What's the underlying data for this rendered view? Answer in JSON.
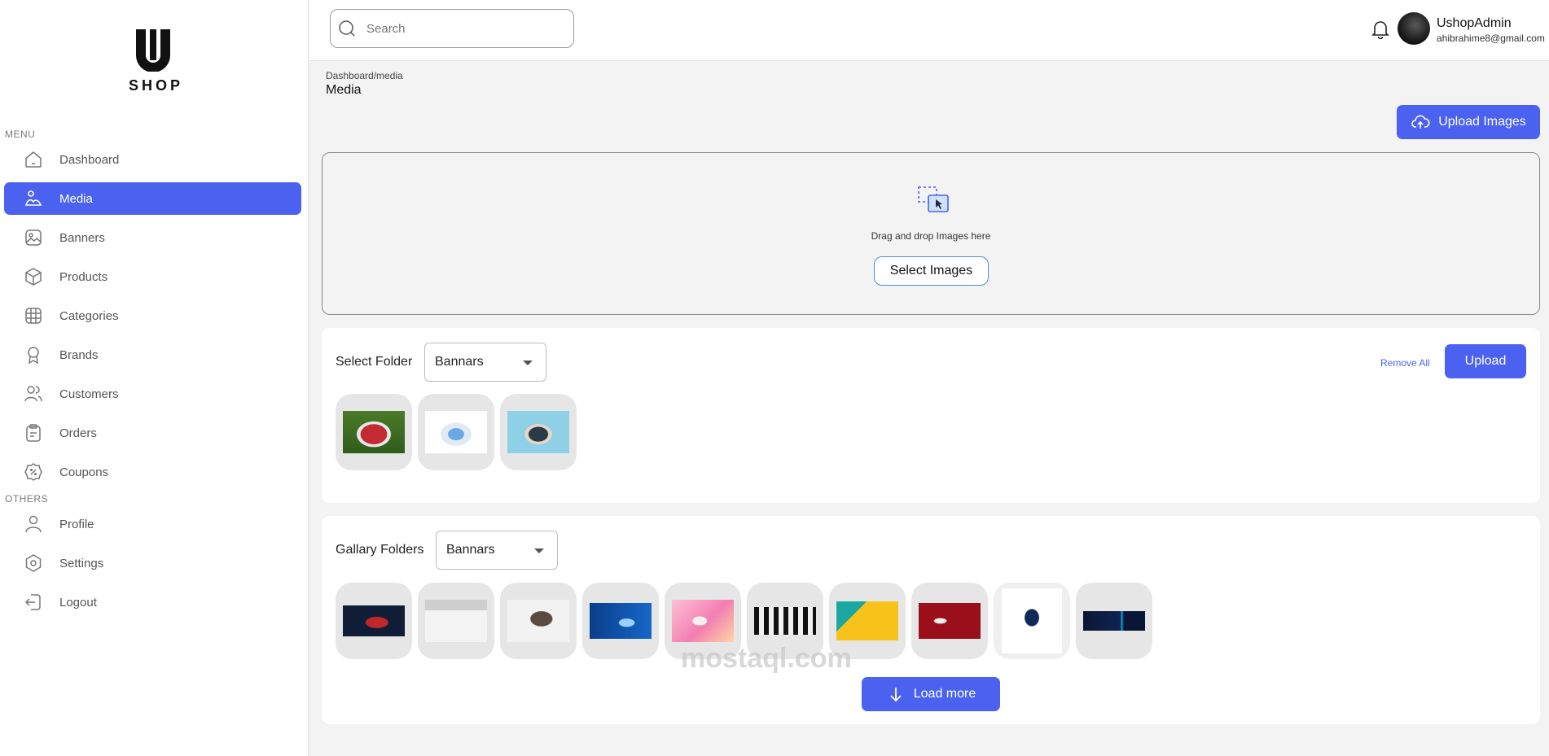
{
  "brand": {
    "logo_letter": "U",
    "name": "SHOP"
  },
  "sidebar": {
    "menu_heading": "MENU",
    "others_heading": "OTHERS",
    "items": [
      {
        "label": "Dashboard",
        "icon": "home-icon"
      },
      {
        "label": "Media",
        "icon": "media-icon",
        "active": true
      },
      {
        "label": "Banners",
        "icon": "image-icon"
      },
      {
        "label": "Products",
        "icon": "box-icon"
      },
      {
        "label": "Categories",
        "icon": "grid-icon"
      },
      {
        "label": "Brands",
        "icon": "badge-icon"
      },
      {
        "label": "Customers",
        "icon": "users-icon"
      },
      {
        "label": "Orders",
        "icon": "clipboard-icon"
      },
      {
        "label": "Coupons",
        "icon": "coupon-icon"
      }
    ],
    "others": [
      {
        "label": "Profile",
        "icon": "user-icon"
      },
      {
        "label": "Settings",
        "icon": "settings-icon"
      },
      {
        "label": "Logout",
        "icon": "logout-icon"
      }
    ]
  },
  "header": {
    "search_placeholder": "Search",
    "user_name": "UshopAdmin",
    "user_email": "ahibrahime8@gmail.com"
  },
  "page": {
    "breadcrumb": "Dashboard/media",
    "title": "Media",
    "upload_images_label": "Upload Images"
  },
  "dropzone": {
    "text": "Drag and drop Images here",
    "select_label": "Select Images"
  },
  "upload_section": {
    "label": "Select Folder",
    "folder_value": "Bannars",
    "remove_all_label": "Remove All",
    "upload_label": "Upload"
  },
  "gallery_section": {
    "label": "Gallary Folders",
    "folder_value": "Bannars",
    "load_more_label": "Load more"
  },
  "watermark": "mostaql.com",
  "colors": {
    "accent": "#4b62f0"
  }
}
